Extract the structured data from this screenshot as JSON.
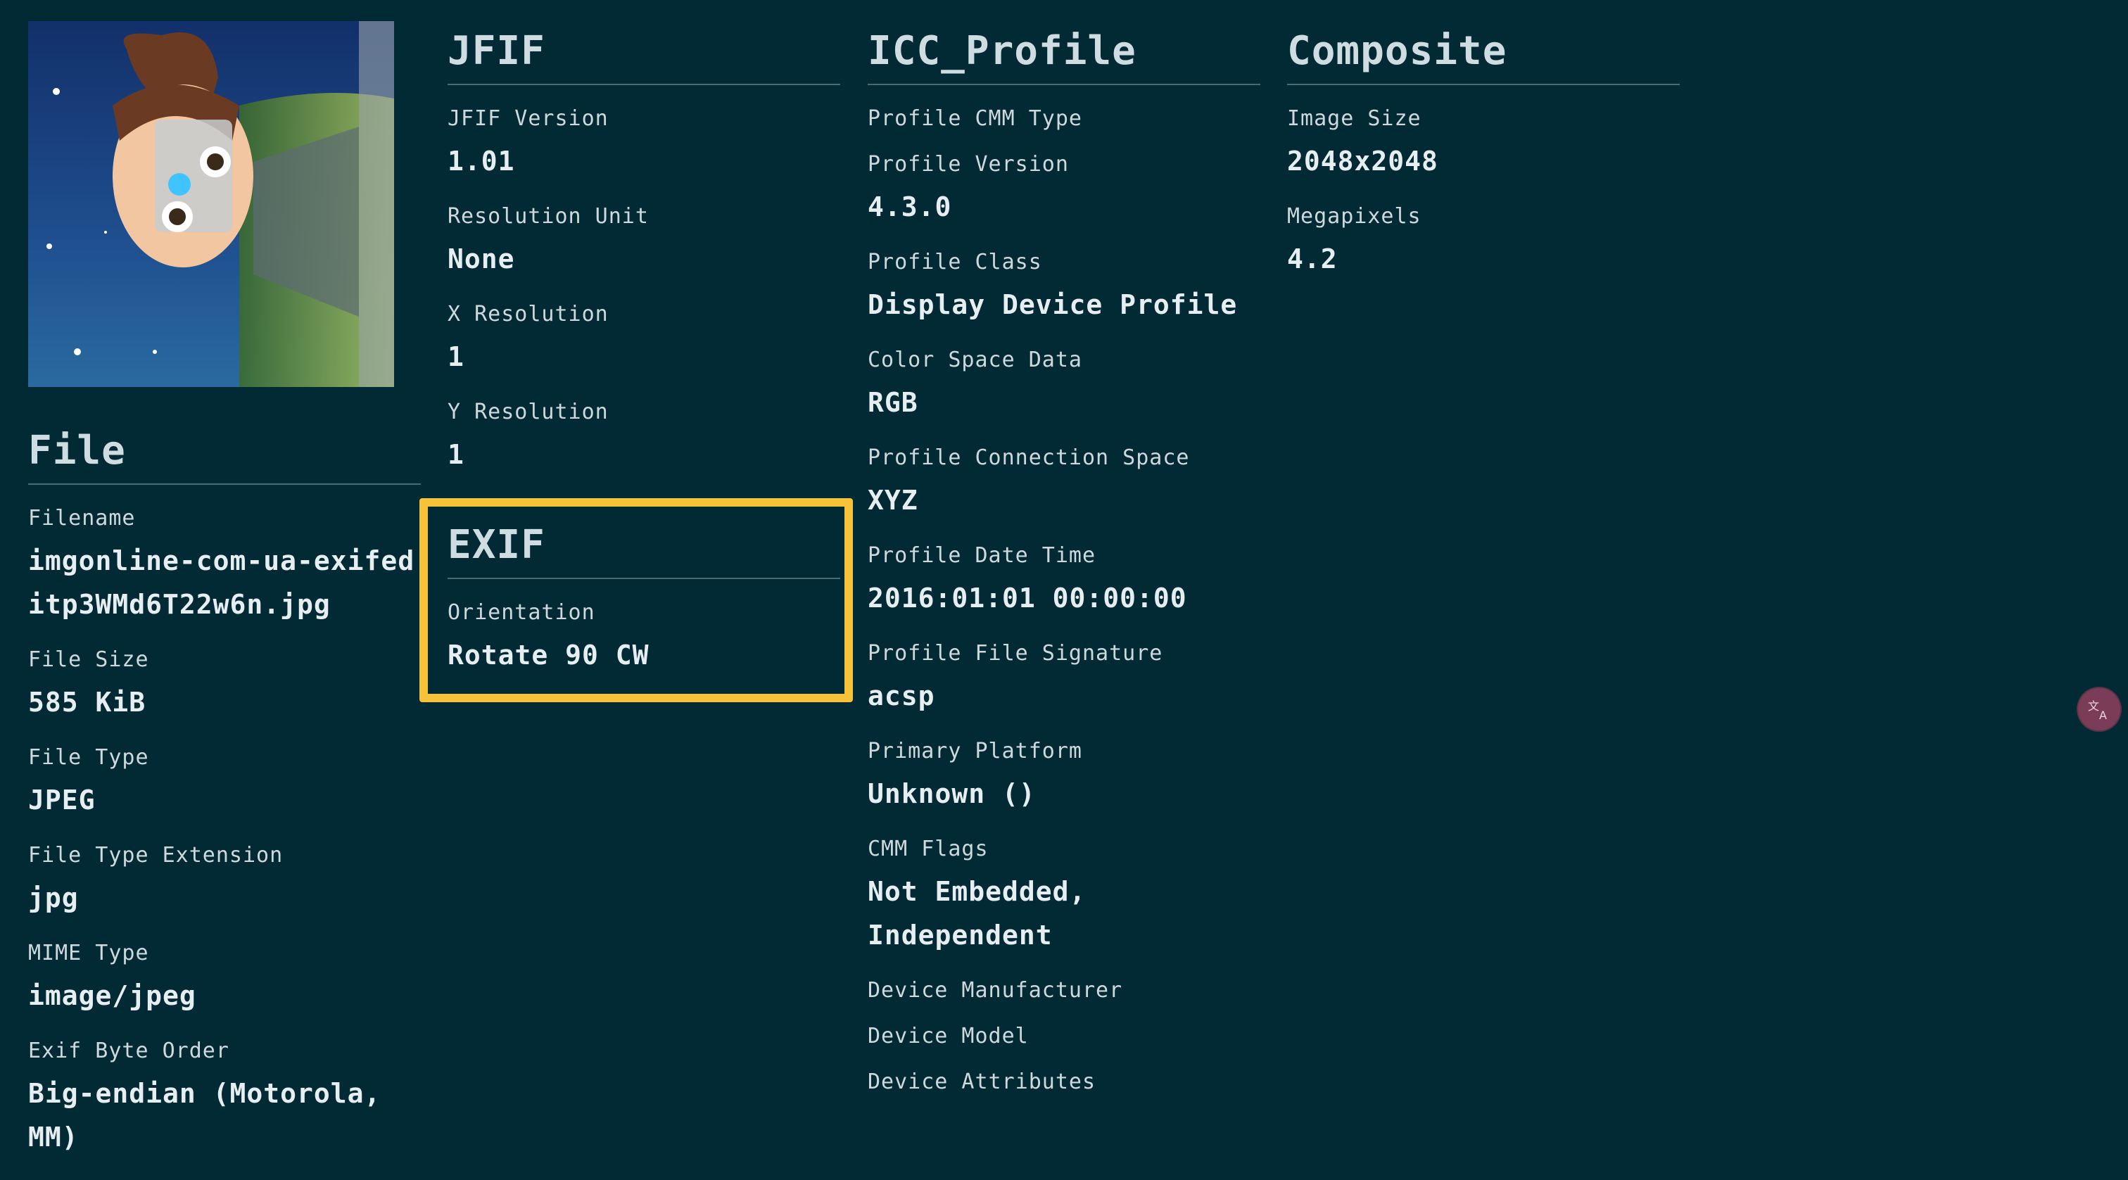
{
  "thumbnail": {
    "alt": "anime portrait thumbnail"
  },
  "file": {
    "title": "File",
    "fields": [
      {
        "label": "Filename",
        "value": "imgonline-com-ua-exifeditp3WMd6T22w6n.jpg"
      },
      {
        "label": "File Size",
        "value": "585 KiB"
      },
      {
        "label": "File Type",
        "value": "JPEG"
      },
      {
        "label": "File Type Extension",
        "value": "jpg"
      },
      {
        "label": "MIME Type",
        "value": "image/jpeg"
      },
      {
        "label": "Exif Byte Order",
        "value": "Big-endian (Motorola, MM)"
      }
    ]
  },
  "jfif": {
    "title": "JFIF",
    "fields": [
      {
        "label": "JFIF Version",
        "value": "1.01"
      },
      {
        "label": "Resolution Unit",
        "value": "None"
      },
      {
        "label": "X Resolution",
        "value": "1"
      },
      {
        "label": "Y Resolution",
        "value": "1"
      }
    ]
  },
  "exif": {
    "title": "EXIF",
    "fields": [
      {
        "label": "Orientation",
        "value": "Rotate 90 CW"
      }
    ]
  },
  "icc": {
    "title": "ICC_Profile",
    "fields": [
      {
        "label": "Profile CMM Type",
        "value": ""
      },
      {
        "label": "Profile Version",
        "value": "4.3.0"
      },
      {
        "label": "Profile Class",
        "value": "Display Device Profile"
      },
      {
        "label": "Color Space Data",
        "value": "RGB"
      },
      {
        "label": "Profile Connection Space",
        "value": "XYZ"
      },
      {
        "label": "Profile Date Time",
        "value": "2016:01:01 00:00:00"
      },
      {
        "label": "Profile File Signature",
        "value": "acsp"
      },
      {
        "label": "Primary Platform",
        "value": "Unknown ()"
      },
      {
        "label": "CMM Flags",
        "value": "Not Embedded, Independent"
      },
      {
        "label": "Device Manufacturer",
        "value": ""
      },
      {
        "label": "Device Model",
        "value": ""
      },
      {
        "label": "Device Attributes",
        "value": ""
      }
    ]
  },
  "composite": {
    "title": "Composite",
    "fields": [
      {
        "label": "Image Size",
        "value": "2048x2048"
      },
      {
        "label": "Megapixels",
        "value": "4.2"
      }
    ]
  },
  "translate_button": {
    "icon": "translate-icon"
  }
}
